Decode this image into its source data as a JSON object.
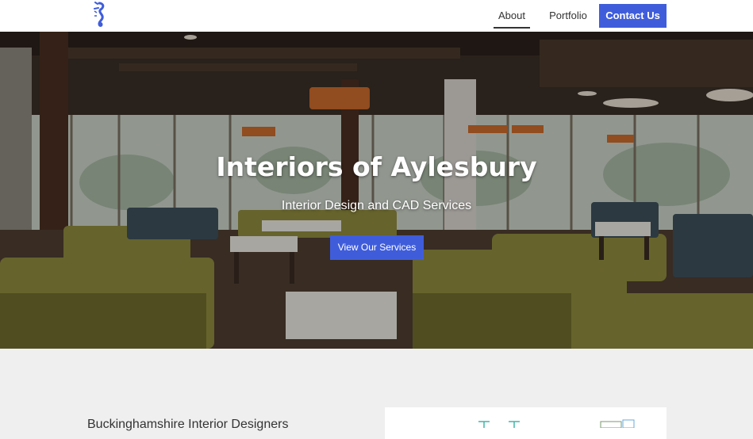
{
  "header": {
    "logo_icon": "seahorse-logo-icon",
    "nav": {
      "about": "About",
      "portfolio": "Portfolio",
      "contact": "Contact Us"
    },
    "accent_color": "#3f5ddb"
  },
  "hero": {
    "title": "Interiors of Aylesbury",
    "subtitle": "Interior Design and CAD Services",
    "button_label": "View Our Services"
  },
  "section": {
    "heading": "Buckinghamshire Interior Designers"
  }
}
